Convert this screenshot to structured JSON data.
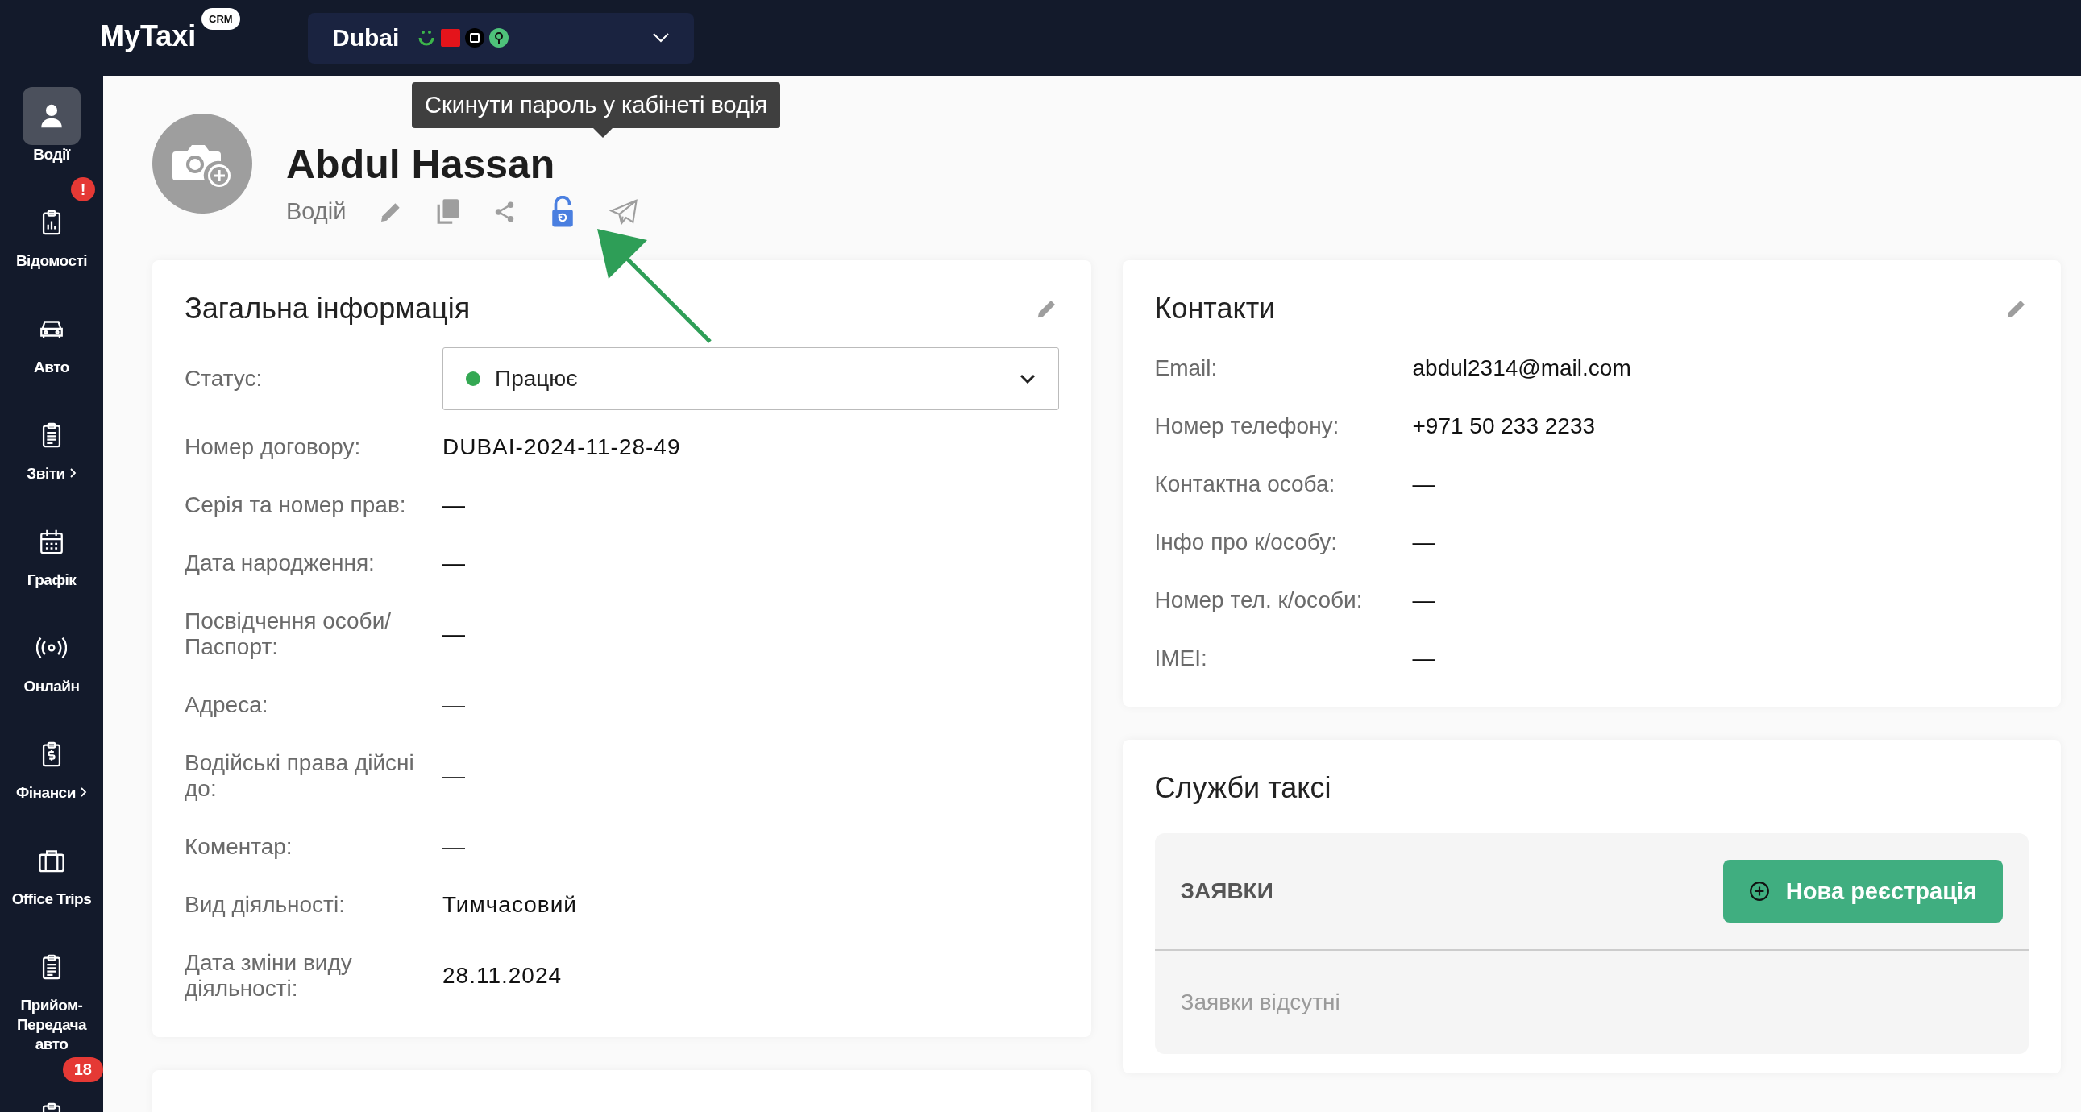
{
  "topbar": {
    "logo": "MyTaxi",
    "logo_badge": "CRM",
    "city": "Dubai",
    "services": [
      {
        "kind": "smile"
      },
      {
        "kind": "red-tile"
      },
      {
        "kind": "black-circle"
      },
      {
        "kind": "pin"
      }
    ]
  },
  "sidebar": {
    "items": [
      {
        "kind": "user",
        "label": "Водії",
        "selected": true,
        "submenu": false
      },
      {
        "kind": "chart",
        "label": "Відомості",
        "selected": false,
        "submenu": false,
        "badge": "!"
      },
      {
        "kind": "car",
        "label": "Авто",
        "selected": false,
        "submenu": false
      },
      {
        "kind": "list",
        "label": "Звіти",
        "selected": false,
        "submenu": true
      },
      {
        "kind": "calendar",
        "label": "Графік",
        "selected": false,
        "submenu": false
      },
      {
        "kind": "broadcast",
        "label": "Онлайн",
        "selected": false,
        "submenu": false
      },
      {
        "kind": "money",
        "label": "Фінанси",
        "selected": false,
        "submenu": true
      },
      {
        "kind": "briefcase",
        "label": "Office Trips",
        "selected": false,
        "submenu": false
      },
      {
        "kind": "list",
        "label": "Прийом-Передача авто",
        "selected": false,
        "submenu": false
      },
      {
        "kind": "list",
        "selected": false,
        "badge": "18"
      }
    ]
  },
  "driver": {
    "name": "Abdul Hassan",
    "role": "Водій",
    "tooltip": "Скинути пароль у кабінеті водія",
    "actions": [
      {
        "kind": "edit",
        "highlighted": false
      },
      {
        "kind": "copy",
        "highlighted": false
      },
      {
        "kind": "share",
        "highlighted": false
      },
      {
        "kind": "unlock",
        "highlighted": true
      },
      {
        "kind": "send",
        "highlighted": false
      }
    ]
  },
  "general": {
    "title": "Загальна інформація",
    "status": {
      "label": "Статус:",
      "value": "Працює",
      "color": "#34a853"
    },
    "rows": [
      {
        "label": "Номер договору:",
        "value": "DUBAI-2024-11-28-49"
      },
      {
        "label": "Серія та номер прав:",
        "value": "—"
      },
      {
        "label": "Дата народження:",
        "value": "—"
      },
      {
        "label": "Посвідчення особи/ Паспорт:",
        "value": "—"
      },
      {
        "label": "Адреса:",
        "value": "—"
      },
      {
        "label": "Водійські права дійсні до:",
        "value": "—"
      },
      {
        "label": "Коментар:",
        "value": "—"
      },
      {
        "label": "Вид діяльності:",
        "value": "Тимчасовий"
      },
      {
        "label": "Дата зміни виду діяльності:",
        "value": "28.11.2024"
      }
    ]
  },
  "contacts": {
    "title": "Контакти",
    "rows": [
      {
        "label": "Email:",
        "value": "abdul2314@mail.com"
      },
      {
        "label": "Номер телефону:",
        "value": "+971 50 233 2233"
      },
      {
        "label": "Контактна особа:",
        "value": "—"
      },
      {
        "label": "Інфо про к/особу:",
        "value": "—"
      },
      {
        "label": "Номер тел. к/особи:",
        "value": "—"
      },
      {
        "label": "IMEI:",
        "value": "—"
      }
    ]
  },
  "taxi_services": {
    "title": "Служби таксі",
    "requests_heading": "ЗАЯВКИ",
    "button": "Нова реєстрація",
    "empty": "Заявки відсутні"
  }
}
